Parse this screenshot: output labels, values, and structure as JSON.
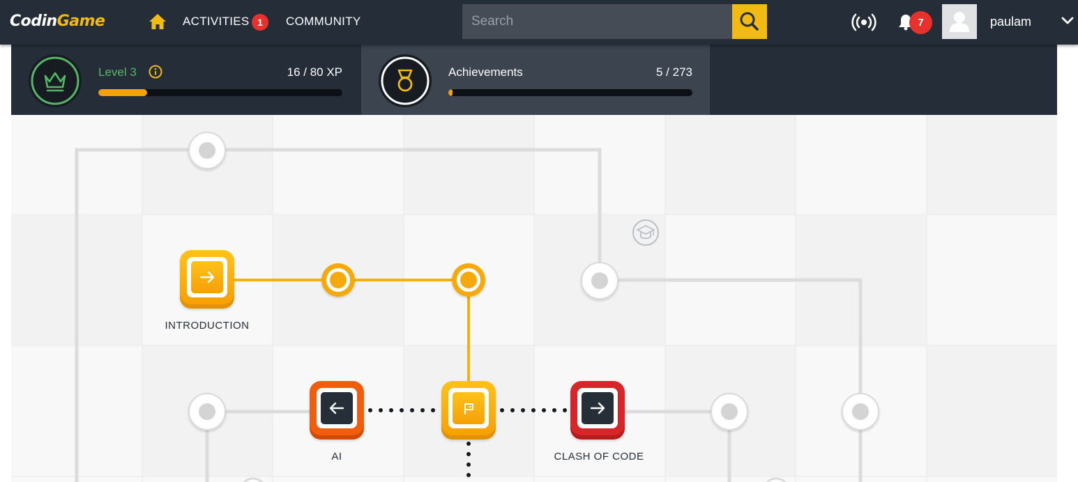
{
  "nav": {
    "logo_cod": "Cod",
    "logo_in": "in",
    "logo_game": "Game",
    "activities_label": "ACTIVITIES",
    "activities_badge": "1",
    "community_label": "COMMUNITY",
    "search_placeholder": "Search",
    "notifications_badge": "7",
    "username": "paulam",
    "icons": [
      "home-icon",
      "search-icon",
      "broadcast-icon",
      "bell-icon",
      "user-icon",
      "chevron-down-icon"
    ]
  },
  "progress": {
    "level": {
      "label": "Level 3",
      "value": "16 / 80 XP",
      "fraction": 0.2,
      "icon": "crown-icon"
    },
    "achievements": {
      "label": "Achievements",
      "value": "5 / 273",
      "fraction": 0.018,
      "icon": "medal-icon"
    }
  },
  "map": {
    "labels": {
      "introduction": "INTRODUCTION",
      "ai": "AI",
      "clash": "CLASH OF CODE"
    },
    "colors": {
      "active_path": "#f2b10b",
      "inactive_path": "#dcdcdc",
      "ai_tile": "#f05d0f",
      "clash_tile": "#d7252a",
      "accent": "#f2bb13"
    }
  }
}
